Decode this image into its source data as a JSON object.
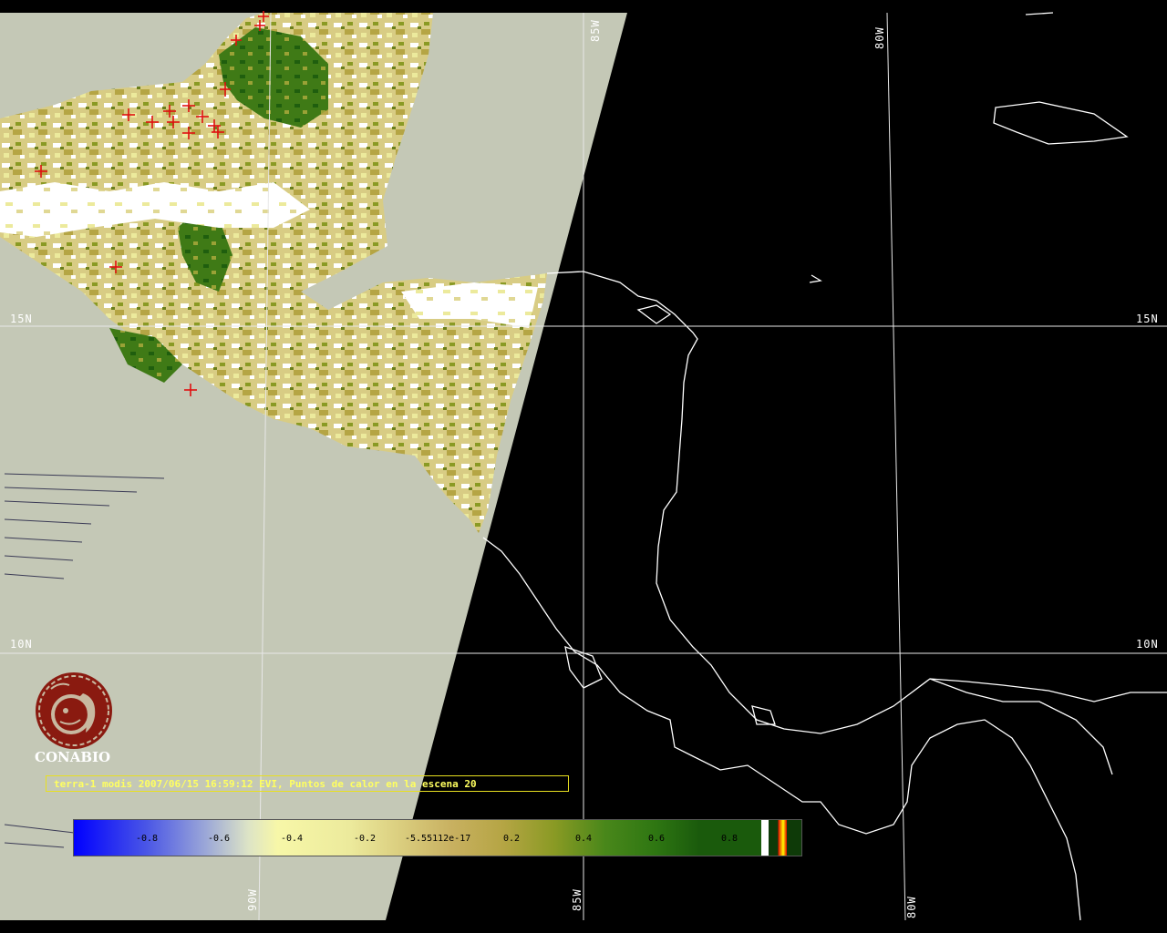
{
  "map": {
    "grid_labels": {
      "lon_top_85": "85W",
      "lon_top_80": "80W",
      "lon_bottom_90": "90W",
      "lon_bottom_85": "85W",
      "lon_bottom_80": "80W",
      "lat_15_left": "15N",
      "lat_15_right": "15N",
      "lat_10_left": "10N",
      "lat_10_right": "10N"
    },
    "colors": {
      "background": "#000000",
      "no_data_gray": "#c4c8b6",
      "coastline": "#ffffff",
      "fire_marker": "#e01010",
      "caption_text": "#ffff60"
    }
  },
  "logo": {
    "name": "CONABIO"
  },
  "caption": {
    "text": "terra-1 modis 2007/06/15 16:59:12 EVI, Puntos de calor en la escena 20"
  },
  "colorbar": {
    "ticks": [
      "-0.8",
      "-0.6",
      "-0.4",
      "-0.2",
      "-5.55112e-17",
      "0.2",
      "0.4",
      "0.6",
      "0.8"
    ]
  }
}
